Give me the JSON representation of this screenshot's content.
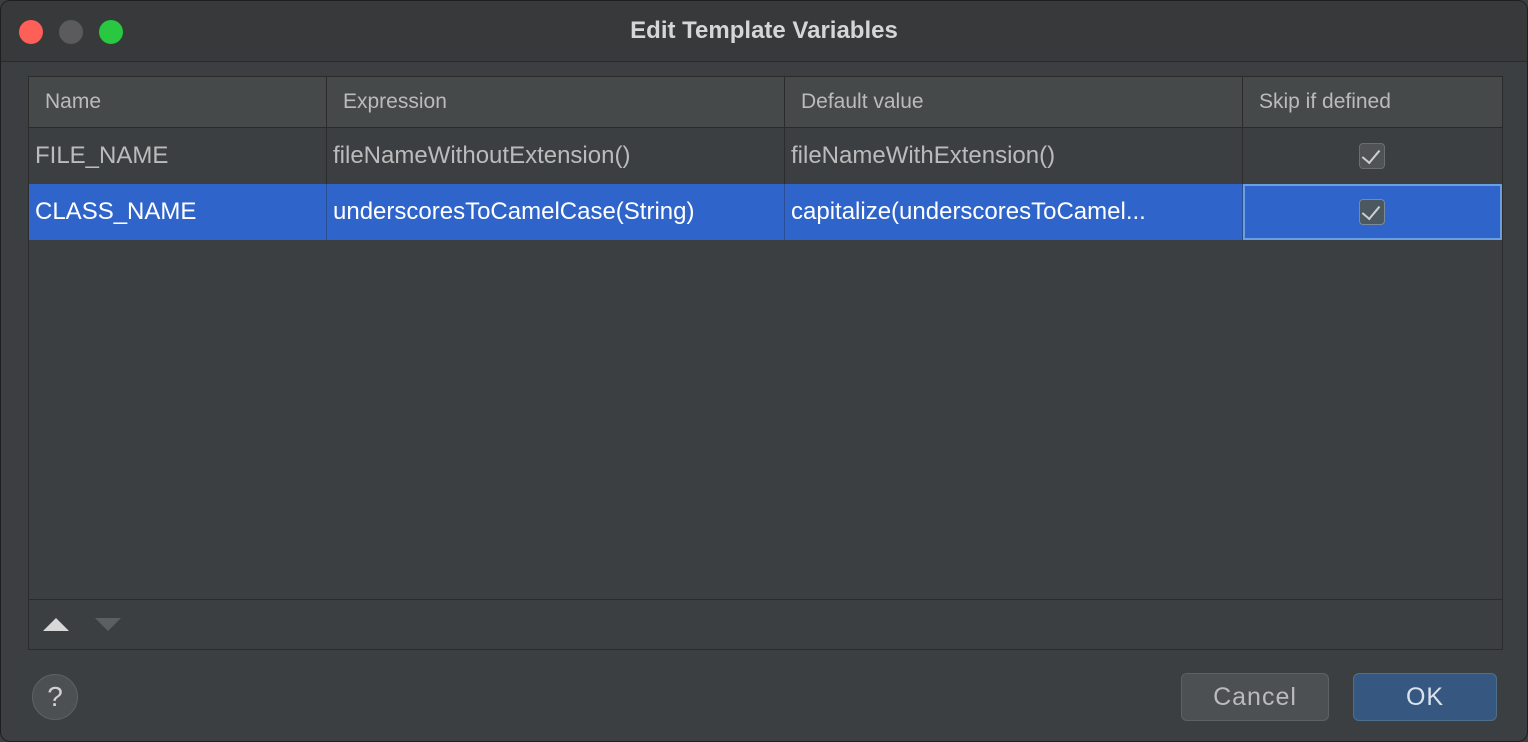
{
  "window": {
    "title": "Edit Template Variables"
  },
  "table": {
    "columns": [
      "Name",
      "Expression",
      "Default value",
      "Skip if defined"
    ],
    "rows": [
      {
        "name": "FILE_NAME",
        "expression": "fileNameWithoutExtension()",
        "default_value": "fileNameWithExtension()",
        "skip_if_defined": true,
        "selected": false
      },
      {
        "name": "CLASS_NAME",
        "expression": "underscoresToCamelCase(String)",
        "default_value": "capitalize(underscoresToCamel...",
        "skip_if_defined": true,
        "selected": true
      }
    ]
  },
  "toolbar": {
    "move_up_icon": "arrow-up-icon",
    "move_down_icon": "arrow-down-icon"
  },
  "footer": {
    "help_label": "?",
    "cancel_label": "Cancel",
    "ok_label": "OK"
  },
  "colors": {
    "selection": "#2f65ca",
    "background": "#3c3f41",
    "ok_button": "#365880"
  }
}
